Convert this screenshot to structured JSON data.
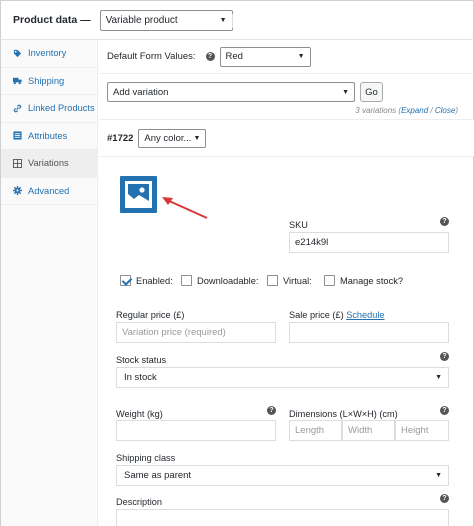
{
  "header": {
    "label": "Product data —",
    "product_type": "Variable product"
  },
  "sidebar": {
    "items": [
      {
        "label": "Inventory",
        "icon": "tag-icon"
      },
      {
        "label": "Shipping",
        "icon": "truck-icon"
      },
      {
        "label": "Linked Products",
        "icon": "link-icon"
      },
      {
        "label": "Attributes",
        "icon": "list-icon"
      },
      {
        "label": "Variations",
        "icon": "grid-icon",
        "active": true
      },
      {
        "label": "Advanced",
        "icon": "gear-icon"
      }
    ]
  },
  "defaults": {
    "label": "Default Form Values:",
    "value": "Red"
  },
  "add_variation": {
    "select": "Add variation",
    "go": "Go",
    "count_text": "3 variations (",
    "expand": "Expand",
    "sep": " / ",
    "close": "Close",
    "count_end": ")"
  },
  "variation": {
    "number": "#1722",
    "color": "Any color..."
  },
  "panel": {
    "sku_label": "SKU",
    "sku_value": "e214k9l",
    "checks": {
      "enabled": "Enabled:",
      "downloadable": "Downloadable:",
      "virtual": "Virtual:",
      "manage_stock": "Manage stock?"
    },
    "regular_price_label": "Regular price (£)",
    "regular_price_placeholder": "Variation price (required)",
    "sale_price_label": "Sale price (£)",
    "schedule": "Schedule",
    "stock_status_label": "Stock status",
    "stock_status_value": "In stock",
    "weight_label": "Weight (kg)",
    "dimensions_label": "Dimensions (L×W×H) (cm)",
    "length": "Length",
    "width": "Width",
    "height": "Height",
    "shipping_class_label": "Shipping class",
    "shipping_class_value": "Same as parent",
    "description_label": "Description"
  },
  "colors": {
    "accent": "#2271b1",
    "arrow": "#d63638"
  }
}
